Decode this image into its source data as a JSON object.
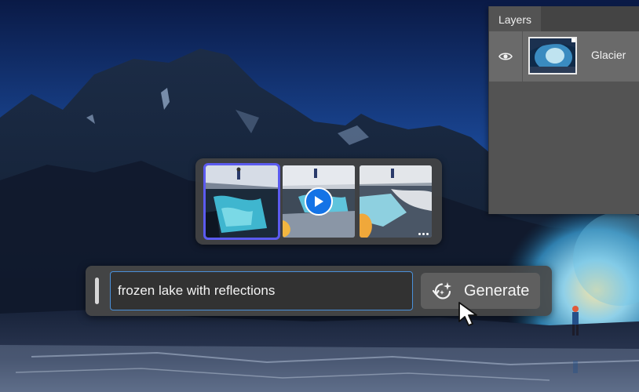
{
  "layers_panel": {
    "tab_label": "Layers",
    "layers": [
      {
        "name": "Glacier",
        "visible": true
      }
    ]
  },
  "variations": {
    "selected_index": 0,
    "items": [
      {
        "id": "variation-1",
        "has_play": false,
        "has_more": false
      },
      {
        "id": "variation-2",
        "has_play": true,
        "has_more": false
      },
      {
        "id": "variation-3",
        "has_play": false,
        "has_more": true
      }
    ]
  },
  "prompt_bar": {
    "prompt_value": "frozen lake with reflections",
    "generate_label": "Generate"
  },
  "colors": {
    "accent_blue": "#1473e6",
    "selection_outline": "#5b5bf0",
    "panel_bg": "#535353",
    "input_border": "#4a90d9"
  },
  "icons": {
    "eye": "eye-icon",
    "generate": "generative-ai-icon",
    "play": "play-icon",
    "cursor": "mouse-pointer-icon"
  }
}
